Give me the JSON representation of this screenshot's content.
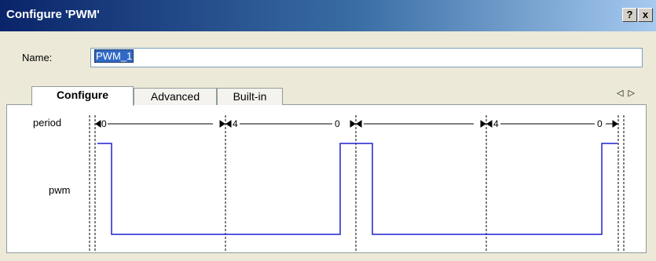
{
  "window": {
    "title": "Configure 'PWM'",
    "help_label": "?",
    "close_label": "x"
  },
  "name_field": {
    "label": "Name:",
    "value": "PWM_1"
  },
  "tabs": [
    {
      "label": "Configure",
      "active": true
    },
    {
      "label": "Advanced",
      "active": false
    },
    {
      "label": "Built-in",
      "active": false
    }
  ],
  "tab_scroll": {
    "left_label": "◁",
    "right_label": "▷"
  },
  "waveform": {
    "signals": [
      "period",
      "pwm"
    ],
    "period_markers": [
      "0",
      "4",
      "0",
      "4",
      "0"
    ],
    "colors": {
      "signal": "#2020d0",
      "divider": "#000000"
    }
  }
}
